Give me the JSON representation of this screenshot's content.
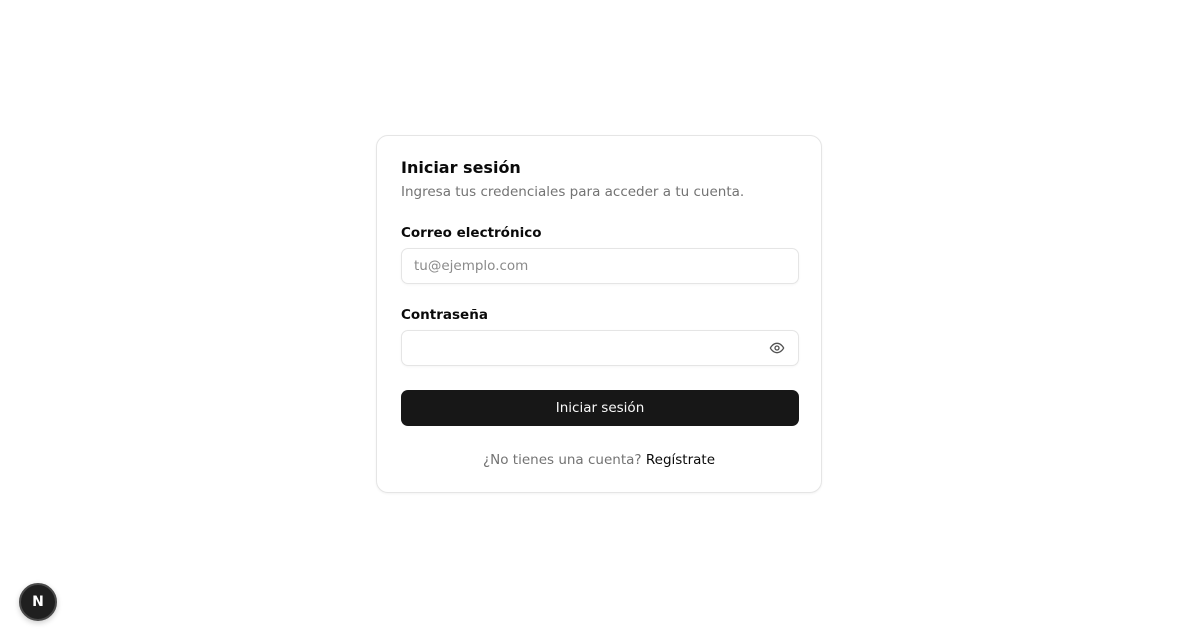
{
  "card": {
    "title": "Iniciar sesión",
    "description": "Ingresa tus credenciales para acceder a tu cuenta."
  },
  "form": {
    "email_label": "Correo electrónico",
    "email_placeholder": "tu@ejemplo.com",
    "email_value": "",
    "password_label": "Contraseña",
    "password_value": "",
    "password_toggle_icon": "eye-icon",
    "submit_label": "Iniciar sesión"
  },
  "footer": {
    "prompt": "¿No tienes una cuenta?",
    "link_label": "Regístrate"
  },
  "dev_badge": {
    "letter": "N"
  },
  "colors": {
    "primary": "#171717",
    "muted_text": "#737373",
    "border": "#e5e5e5"
  }
}
